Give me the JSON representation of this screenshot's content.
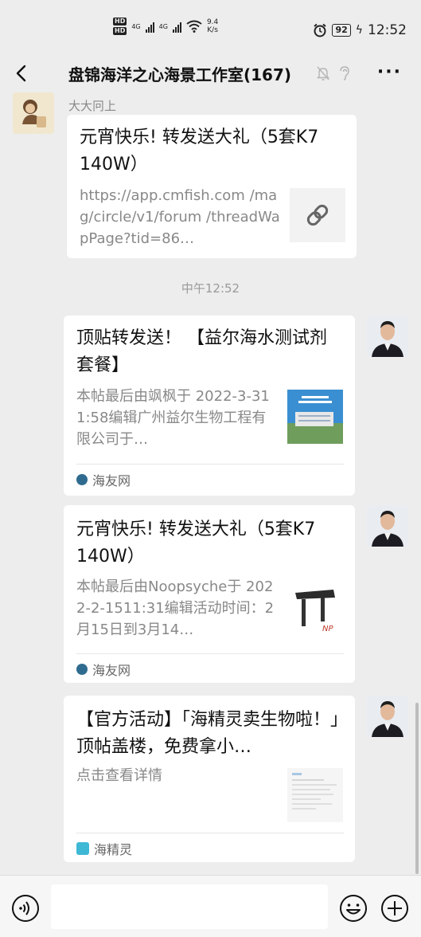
{
  "status_bar": {
    "hd1": "HD",
    "hd2": "HD",
    "net1": "4G",
    "net2": "4G",
    "speed_value": "9.4",
    "speed_unit": "K/s",
    "battery": "92",
    "time": "12:52"
  },
  "header": {
    "title": "盘锦海洋之心海景工作室(167)",
    "more": "···"
  },
  "messages": [
    {
      "sender": "大大冋上",
      "title": "元宵快乐! 转发送大礼（5套K7 140W）",
      "desc": "https://app.cmfish.com /mag/circle/v1/forum /threadWapPage?tid=86…"
    },
    {
      "title": "顶贴转发送！ 【益尔海水测试剂套餐】",
      "desc": "本帖最后由飒枫于 2022-3-311:58编辑广州益尔生物工程有限公司于…",
      "source": "海友网"
    },
    {
      "title": "元宵快乐! 转发送大礼（5套K7 140W）",
      "desc": "本帖最后由Noopsyche于 2022-2-1511:31编辑活动时间：2月15日到3月14…",
      "source": "海友网"
    },
    {
      "title": "【官方活动】「海精灵卖生物啦！」顶帖盖楼，免费拿小…",
      "desc": "点击查看详情",
      "source": "海精灵"
    }
  ],
  "time_divider": "中午12:52",
  "colors": {
    "background": "#ededed",
    "card": "#ffffff",
    "muted_text": "#888888"
  }
}
